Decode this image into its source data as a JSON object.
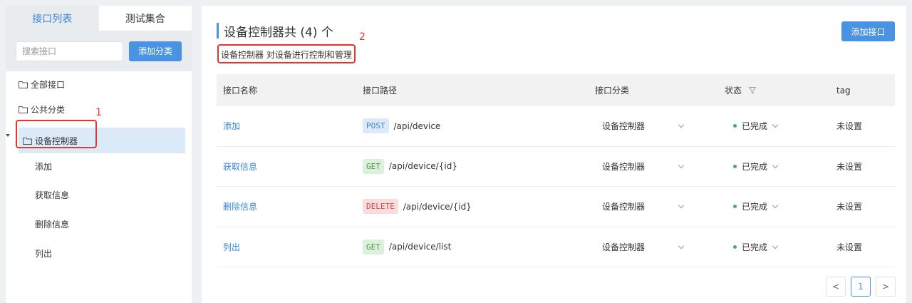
{
  "sidebar": {
    "tabs": [
      {
        "label": "接口列表",
        "active": true
      },
      {
        "label": "测试集合",
        "active": false
      }
    ],
    "search_placeholder": "搜索接口",
    "add_category_label": "添加分类",
    "nodes": [
      {
        "label": "全部接口"
      },
      {
        "label": "公共分类"
      },
      {
        "label": "设备控制器",
        "selected": true,
        "expanded": true
      }
    ],
    "children": [
      {
        "label": "添加"
      },
      {
        "label": "获取信息"
      },
      {
        "label": "删除信息"
      },
      {
        "label": "列出"
      }
    ]
  },
  "main": {
    "title": "设备控制器共 (4) 个",
    "description": "设备控制器 对设备进行控制和管理",
    "add_api_label": "添加接口",
    "columns": [
      "接口名称",
      "接口路径",
      "接口分类",
      "状态",
      "tag"
    ],
    "rows": [
      {
        "name": "添加",
        "method": "POST",
        "path": "/api/device",
        "category": "设备控制器",
        "status": "已完成",
        "tag": "未设置"
      },
      {
        "name": "获取信息",
        "method": "GET",
        "path": "/api/device/{id}",
        "category": "设备控制器",
        "status": "已完成",
        "tag": "未设置"
      },
      {
        "name": "删除信息",
        "method": "DELETE",
        "path": "/api/device/{id}",
        "category": "设备控制器",
        "status": "已完成",
        "tag": "未设置"
      },
      {
        "name": "列出",
        "method": "GET",
        "path": "/api/device/list",
        "category": "设备控制器",
        "status": "已完成",
        "tag": "未设置"
      }
    ],
    "pagination": {
      "prev": "<",
      "current": "1",
      "next": ">"
    }
  },
  "annotations": [
    {
      "number": "1"
    },
    {
      "number": "2"
    }
  ],
  "colors": {
    "accent": "#4a93e3",
    "annotation": "#e0372f",
    "status_done": "#4caf50"
  }
}
